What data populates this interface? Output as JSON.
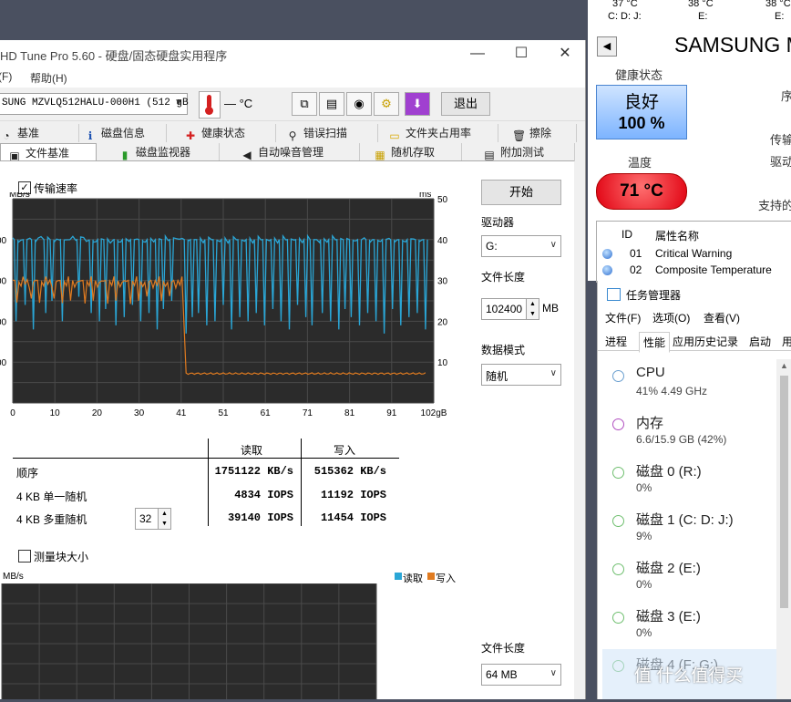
{
  "hdtune": {
    "title": "HD Tune Pro 5.60 - 硬盘/固态硬盘实用程序",
    "menu": [
      "(F)",
      "帮助(H)"
    ],
    "drive_combo": "SUNG MZVLQ512HALU-000H1 (512 gB",
    "temp_value": "— °C",
    "exit_label": "退出",
    "tabs_row1": [
      {
        "label": "基准",
        "icon": "speedometer-icon"
      },
      {
        "label": "磁盘信息",
        "icon": "info-icon"
      },
      {
        "label": "健康状态",
        "icon": "health-cross-icon"
      },
      {
        "label": "错误扫描",
        "icon": "magnifier-icon"
      },
      {
        "label": "文件夹占用率",
        "icon": "folder-icon"
      },
      {
        "label": "擦除",
        "icon": "trash-icon"
      }
    ],
    "tabs_row2": [
      {
        "label": "文件基准",
        "icon": "file-benchmark-icon"
      },
      {
        "label": "磁盘监视器",
        "icon": "bar-chart-icon"
      },
      {
        "label": "自动噪音管理",
        "icon": "speaker-icon"
      },
      {
        "label": "随机存取",
        "icon": "random-access-icon"
      },
      {
        "label": "附加测试",
        "icon": "extra-tests-icon"
      }
    ],
    "transfer_rate_label": "传输速率",
    "start_label": "开始",
    "drive_label": "驱动器",
    "drive_value": "G:",
    "file_length_label": "文件长度",
    "file_length_value": "102400",
    "file_length_unit": "MB",
    "data_mode_label": "数据模式",
    "data_mode_value": "随机",
    "block_size_label": "测量块大小",
    "file_length2_label": "文件长度",
    "file_length2_value": "64 MB",
    "legend_read": "读取",
    "legend_write": "写入",
    "lower_chart_unit": "MB/s",
    "results": {
      "col_read": "读取",
      "col_write": "写入",
      "rows": [
        {
          "label": "顺序",
          "read": "1751122 KB/s",
          "write": "515362 KB/s"
        },
        {
          "label": "4 KB 单一随机",
          "read": "4834 IOPS",
          "write": "11192 IOPS"
        },
        {
          "label": "4 KB 多重随机",
          "read": "39140 IOPS",
          "write": "11454 IOPS"
        }
      ],
      "queue_depth": "32"
    }
  },
  "chart_data": {
    "type": "line",
    "ylabel": "MB/s",
    "y2label": "ms",
    "x_tick_labels": [
      "0",
      "10",
      "20",
      "30",
      "41",
      "51",
      "61",
      "71",
      "81",
      "91",
      "102gB"
    ],
    "y_tick_labels_left": [
      "00",
      "00",
      "00",
      "00"
    ],
    "y_tick_labels_right": [
      "50",
      "40",
      "30",
      "20",
      "10"
    ],
    "xlim": [
      0,
      102
    ],
    "ylim_right": [
      0,
      50
    ],
    "grid": true,
    "series": [
      {
        "name": "读取",
        "color": "#2aa6d6",
        "baseline": 40,
        "dips": [
          0.8,
          3,
          5,
          8,
          9.5,
          12,
          16,
          19,
          21,
          22.5,
          25,
          27,
          29,
          31,
          33,
          35,
          36.5,
          38.5,
          42,
          43.5,
          45,
          47,
          49,
          51,
          53,
          55,
          57,
          59,
          61,
          63,
          65,
          67,
          69,
          71,
          72.5,
          75,
          77,
          79,
          80.5,
          82,
          84,
          86,
          88,
          90,
          92,
          94,
          96,
          98,
          100
        ],
        "dip_min": [
          20,
          24,
          18,
          22,
          25,
          20,
          26,
          22,
          20,
          23,
          19,
          21,
          24,
          20,
          22,
          18,
          23,
          25,
          17,
          21,
          22,
          19,
          20,
          24,
          18,
          21,
          20,
          22,
          19,
          23,
          20,
          18,
          24,
          21,
          19,
          22,
          20,
          18,
          23,
          21,
          19,
          22,
          20,
          17,
          23,
          19,
          21,
          22,
          18
        ]
      },
      {
        "name": "写入",
        "color": "#e07b20",
        "segments": [
          {
            "x": [
              0,
              41
            ],
            "y": 29.5
          },
          {
            "x": [
              42,
              100
            ],
            "y": 7.2
          }
        ]
      }
    ]
  },
  "samsung": {
    "temps": [
      {
        "t": "37 °C",
        "d": "C: D: J:"
      },
      {
        "t": "38 °C",
        "d": "E:"
      },
      {
        "t": "38 °C",
        "d": "E:"
      }
    ],
    "model": "SAMSUNG M",
    "health_label": "健康状态",
    "health_status": "良好",
    "health_percent": "100 %",
    "temp_label": "温度",
    "temp_value": "71 °C",
    "side_labels": [
      "序",
      "传输",
      "驱动",
      "支持的"
    ],
    "table_header": {
      "id": "ID",
      "name": "属性名称"
    },
    "attrs": [
      {
        "id": "01",
        "name": "Critical Warning"
      },
      {
        "id": "02",
        "name": "Composite Temperature"
      }
    ]
  },
  "taskmgr": {
    "title": "任务管理器",
    "menu": [
      "文件(F)",
      "选项(O)",
      "查看(V)"
    ],
    "tabs": [
      "进程",
      "性能",
      "应用历史记录",
      "启动",
      "用"
    ],
    "items": [
      {
        "name": "CPU",
        "sub": "41% 4.49 GHz",
        "color": "#6a9fcf"
      },
      {
        "name": "内存",
        "sub": "6.6/15.9 GB (42%)",
        "color": "#b04fc0"
      },
      {
        "name": "磁盘 0 (R:)",
        "sub": "0%",
        "color": "#6fbf6f"
      },
      {
        "name": "磁盘 1 (C: D: J:)",
        "sub": "9%",
        "color": "#6fbf6f"
      },
      {
        "name": "磁盘 2 (E:)",
        "sub": "0%",
        "color": "#6fbf6f"
      },
      {
        "name": "磁盘 3 (E:)",
        "sub": "0%",
        "color": "#6fbf6f"
      },
      {
        "name": "磁盘 4 (F: G:)",
        "sub": "",
        "color": "#6fbf6f"
      }
    ],
    "watermark": "值 什么值得买"
  }
}
